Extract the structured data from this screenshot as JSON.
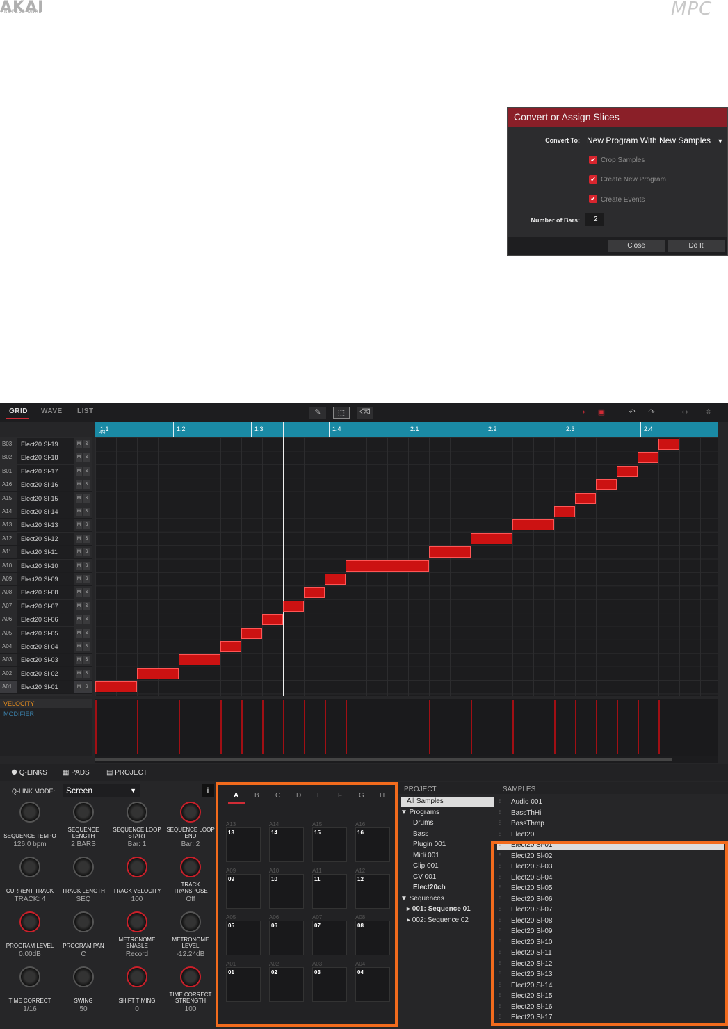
{
  "brand": {
    "akai": "AKAI",
    "professional": "PROFESSIONAL",
    "mpc": "MPC"
  },
  "dialog": {
    "title": "Convert or Assign Slices",
    "convert_to_label": "Convert To:",
    "convert_to_value": "New Program With New Samples",
    "options": [
      "Crop Samples",
      "Create New Program",
      "Create Events"
    ],
    "bars_label": "Number of Bars:",
    "bars_value": "2",
    "close": "Close",
    "do_it": "Do It"
  },
  "editor": {
    "tabs": [
      "GRID",
      "WAVE",
      "LIST"
    ],
    "ruler": [
      "1.1",
      "1.2",
      "1.3",
      "1.4",
      "2.1",
      "2.2",
      "2.3",
      "2.4"
    ],
    "ruler_sub": "4/4",
    "tracks": [
      {
        "id": "B03",
        "name": "Elect20 Sl-19"
      },
      {
        "id": "B02",
        "name": "Elect20 Sl-18"
      },
      {
        "id": "B01",
        "name": "Elect20 Sl-17"
      },
      {
        "id": "A16",
        "name": "Elect20 Sl-16"
      },
      {
        "id": "A15",
        "name": "Elect20 Sl-15"
      },
      {
        "id": "A14",
        "name": "Elect20 Sl-14"
      },
      {
        "id": "A13",
        "name": "Elect20 Sl-13"
      },
      {
        "id": "A12",
        "name": "Elect20 Sl-12"
      },
      {
        "id": "A11",
        "name": "Elect20 Sl-11"
      },
      {
        "id": "A10",
        "name": "Elect20 Sl-10"
      },
      {
        "id": "A09",
        "name": "Elect20 Sl-09"
      },
      {
        "id": "A08",
        "name": "Elect20 Sl-08"
      },
      {
        "id": "A07",
        "name": "Elect20 Sl-07"
      },
      {
        "id": "A06",
        "name": "Elect20 Sl-06"
      },
      {
        "id": "A05",
        "name": "Elect20 Sl-05"
      },
      {
        "id": "A04",
        "name": "Elect20 Sl-04"
      },
      {
        "id": "A03",
        "name": "Elect20 Sl-03"
      },
      {
        "id": "A02",
        "name": "Elect20 Sl-02"
      },
      {
        "id": "A01",
        "name": "Elect20 Sl-01"
      }
    ],
    "mute": "M",
    "solo": "S",
    "lanes": [
      "VELOCITY",
      "MODIFIER"
    ]
  },
  "bottom_tabs": [
    "Q-LINKS",
    "PADS",
    "PROJECT"
  ],
  "qlink": {
    "mode_label": "Q-LINK MODE:",
    "mode_value": "Screen",
    "info": "i",
    "knobs": [
      {
        "label": "SEQUENCE TEMPO",
        "value": "126.0 bpm",
        "red": false
      },
      {
        "label": "SEQUENCE LENGTH",
        "value": "2 BARS",
        "red": false
      },
      {
        "label": "SEQUENCE LOOP START",
        "value": "Bar: 1",
        "red": false
      },
      {
        "label": "SEQUENCE LOOP END",
        "value": "Bar: 2",
        "red": true
      },
      {
        "label": "CURRENT TRACK",
        "value": "TRACK: 4",
        "red": false
      },
      {
        "label": "TRACK LENGTH",
        "value": "SEQ",
        "red": false
      },
      {
        "label": "TRACK VELOCITY",
        "value": "100",
        "red": true
      },
      {
        "label": "TRACK TRANSPOSE",
        "value": "Off",
        "red": true
      },
      {
        "label": "PROGRAM LEVEL",
        "value": "0.00dB",
        "red": true
      },
      {
        "label": "PROGRAM PAN",
        "value": "C",
        "red": false
      },
      {
        "label": "METRONOME ENABLE",
        "value": "Record",
        "red": true
      },
      {
        "label": "METRONOME LEVEL",
        "value": "-12.24dB",
        "red": false
      },
      {
        "label": "TIME CORRECT",
        "value": "1/16",
        "red": false
      },
      {
        "label": "SWING",
        "value": "50",
        "red": false
      },
      {
        "label": "SHIFT TIMING",
        "value": "0",
        "red": true
      },
      {
        "label": "TIME CORRECT STRENGTH",
        "value": "100",
        "red": true
      }
    ]
  },
  "pads": {
    "banks": [
      "A",
      "B",
      "C",
      "D",
      "E",
      "F",
      "G",
      "H"
    ],
    "rows": [
      [
        {
          "lbl": "A13",
          "num": "13"
        },
        {
          "lbl": "A14",
          "num": "14"
        },
        {
          "lbl": "A15",
          "num": "15"
        },
        {
          "lbl": "A16",
          "num": "16"
        }
      ],
      [
        {
          "lbl": "A09",
          "num": "09"
        },
        {
          "lbl": "A10",
          "num": "10"
        },
        {
          "lbl": "A11",
          "num": "11"
        },
        {
          "lbl": "A12",
          "num": "12"
        }
      ],
      [
        {
          "lbl": "A05",
          "num": "05"
        },
        {
          "lbl": "A06",
          "num": "06"
        },
        {
          "lbl": "A07",
          "num": "07"
        },
        {
          "lbl": "A08",
          "num": "08"
        }
      ],
      [
        {
          "lbl": "A01",
          "num": "01"
        },
        {
          "lbl": "A02",
          "num": "02"
        },
        {
          "lbl": "A03",
          "num": "03"
        },
        {
          "lbl": "A04",
          "num": "04"
        }
      ]
    ]
  },
  "project": {
    "header": "PROJECT",
    "items": [
      {
        "text": "All Samples",
        "indent": 0,
        "sel": true
      },
      {
        "text": "▼ Programs",
        "indent": 0
      },
      {
        "text": "Drums",
        "indent": 2
      },
      {
        "text": "Bass",
        "indent": 2
      },
      {
        "text": "Plugin 001",
        "indent": 2
      },
      {
        "text": "Midi 001",
        "indent": 2
      },
      {
        "text": "Clip 001",
        "indent": 2
      },
      {
        "text": "CV 001",
        "indent": 2
      },
      {
        "text": "Elect20ch",
        "indent": 2,
        "bold": true
      },
      {
        "text": "▼ Sequences",
        "indent": 0
      },
      {
        "text": "▸  001: Sequence 01",
        "indent": 1,
        "bold": true
      },
      {
        "text": "▸  002: Sequence 02",
        "indent": 1
      }
    ]
  },
  "samples": {
    "header": "SAMPLES",
    "items": [
      "Audio 001",
      "BassThHi",
      "BassThmp",
      "Elect20",
      "Elect20 Sl-01",
      "Elect20 Sl-02",
      "Elect20 Sl-03",
      "Elect20 Sl-04",
      "Elect20 Sl-05",
      "Elect20 Sl-06",
      "Elect20 Sl-07",
      "Elect20 Sl-08",
      "Elect20 Sl-09",
      "Elect20 Sl-10",
      "Elect20 Sl-11",
      "Elect20 Sl-12",
      "Elect20 Sl-13",
      "Elect20 Sl-14",
      "Elect20 Sl-15",
      "Elect20 Sl-16",
      "Elect20 Sl-17"
    ],
    "selected": "Elect20 Sl-01"
  },
  "colors": {
    "accent": "#cc1212",
    "highlight": "#f26b1d",
    "ruler": "#1a8aa5"
  }
}
